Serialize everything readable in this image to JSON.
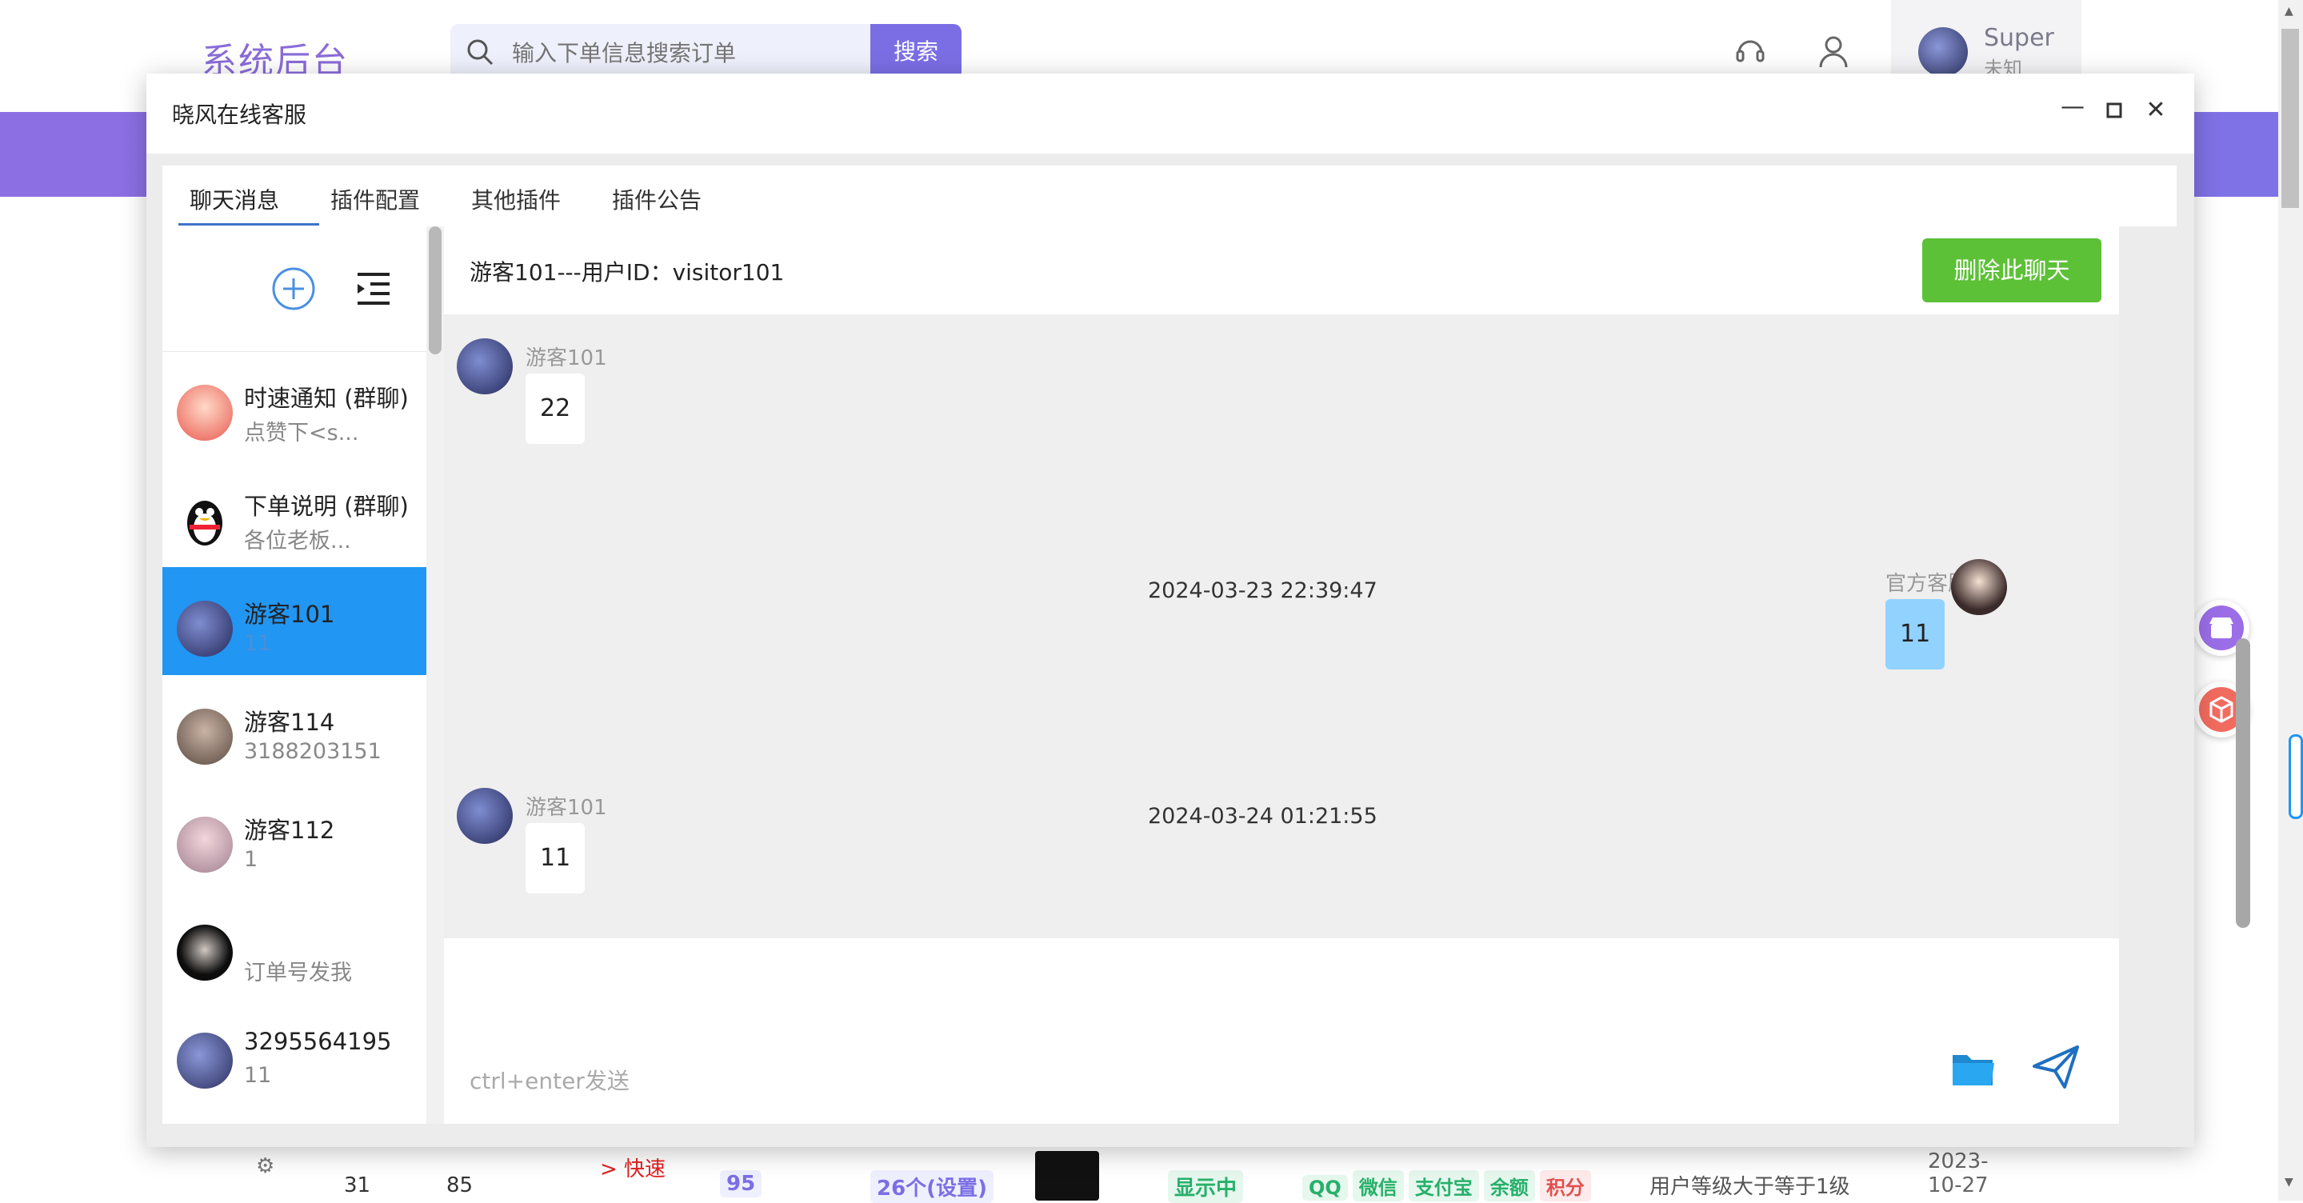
{
  "app": {
    "logo": "系统后台",
    "search": {
      "placeholder": "输入下单信息搜索订单",
      "button": "搜索"
    },
    "user": {
      "name": "Super",
      "sub": "未知"
    }
  },
  "table_row": {
    "id": "31",
    "sort": "85",
    "name": "> 快速",
    "count": "95",
    "spec": "26个(设置)",
    "status": "显示中",
    "pay_tags": [
      "QQ",
      "微信",
      "支付宝",
      "余额",
      "积分"
    ],
    "condition": "用户等级大于等于1级",
    "date": "2023-10-27"
  },
  "modal": {
    "title": "晓风在线客服",
    "tabs": [
      "聊天消息",
      "插件配置",
      "其他插件",
      "插件公告"
    ],
    "contacts": [
      {
        "name": "时速通知 (群聊)",
        "preview": "点赞下<s..."
      },
      {
        "name": "下单说明 (群聊)",
        "preview": "各位老板..."
      },
      {
        "name": "游客101",
        "preview": "11",
        "active": true
      },
      {
        "name": "游客114",
        "preview": "3188203151"
      },
      {
        "name": "游客112",
        "preview": "1"
      },
      {
        "name": "",
        "preview": "订单号发我"
      },
      {
        "name": "3295564195",
        "preview": "11"
      }
    ],
    "chat": {
      "header": "游客101---用户ID：visitor101",
      "delete_button": "删除此聊天",
      "messages": [
        {
          "from": "游客101",
          "text": "22",
          "side": "left"
        },
        {
          "time": "2024-03-23 22:39:47"
        },
        {
          "from": "官方客服",
          "text": "11",
          "side": "right"
        },
        {
          "time": "2024-03-24 01:21:55"
        },
        {
          "from": "游客101",
          "text": "11",
          "side": "left"
        }
      ],
      "input_placeholder": "ctrl+enter发送"
    }
  },
  "colors": {
    "accent_purple": "#7b6ee4",
    "active_blue": "#2196f3",
    "delete_green": "#5cc136",
    "my_bubble": "#91d2ff"
  }
}
